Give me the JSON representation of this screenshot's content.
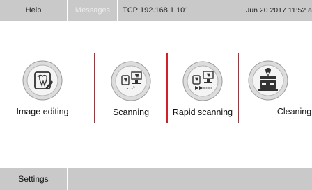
{
  "header": {
    "help_label": "Help",
    "messages_label": "Messages",
    "connection_label": "TCP:192.168.1.101",
    "datetime_label": "Jun 20 2017  11:52 a"
  },
  "tiles": [
    {
      "label": "Image editing",
      "icon": "image-editing-icon",
      "selected": false
    },
    {
      "label": "Scanning",
      "icon": "scanning-icon",
      "selected": true
    },
    {
      "label": "Rapid scanning",
      "icon": "rapid-scanning-icon",
      "selected": true
    },
    {
      "label": "Cleaning",
      "icon": "cleaning-icon",
      "selected": false
    }
  ],
  "footer": {
    "settings_label": "Settings"
  },
  "colors": {
    "bar_gray": "#c9c9c9",
    "selection_red": "#d0202a"
  }
}
